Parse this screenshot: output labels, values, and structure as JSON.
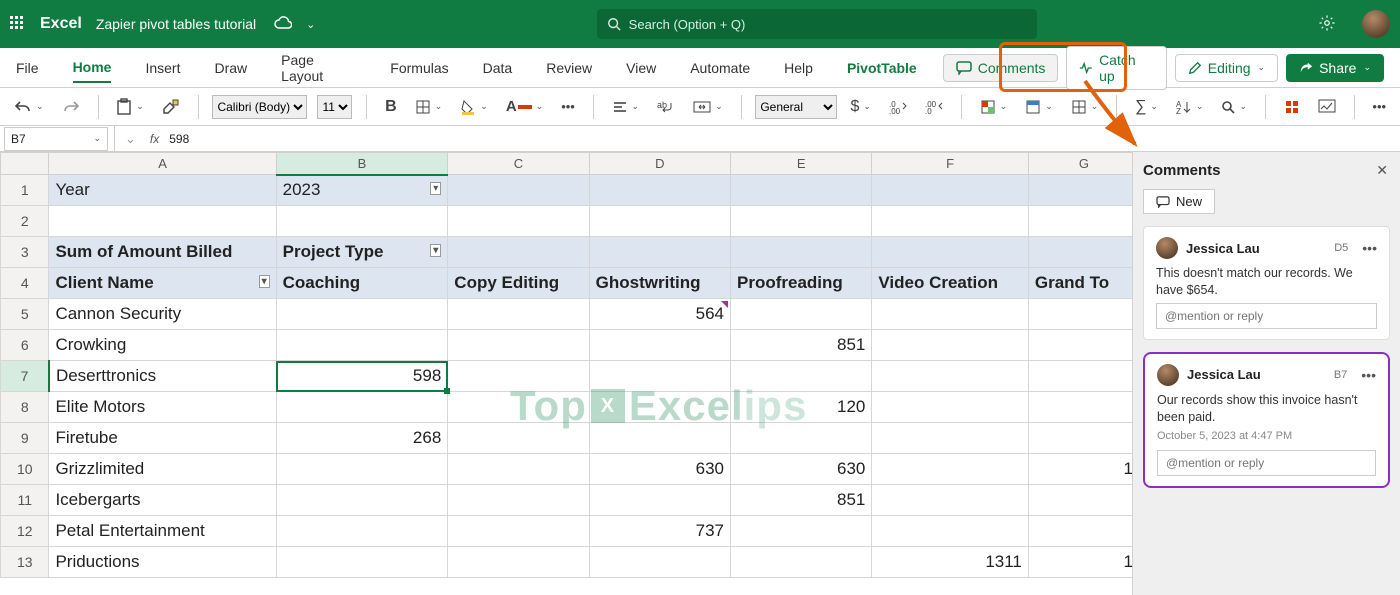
{
  "titlebar": {
    "app": "Excel",
    "doc": "Zapier pivot tables tutorial",
    "search_placeholder": "Search (Option + Q)"
  },
  "tabs": {
    "file": "File",
    "home": "Home",
    "insert": "Insert",
    "draw": "Draw",
    "page_layout": "Page Layout",
    "formulas": "Formulas",
    "data": "Data",
    "review": "Review",
    "view": "View",
    "automate": "Automate",
    "help": "Help",
    "pivot": "PivotTable"
  },
  "actions": {
    "comments": "Comments",
    "catchup": "Catch up",
    "editing": "Editing",
    "share": "Share"
  },
  "toolbar": {
    "font": "Calibri (Body)",
    "size": "11",
    "numfmt": "General"
  },
  "fx": {
    "namebox": "B7",
    "value": "598"
  },
  "columns": [
    "A",
    "B",
    "C",
    "D",
    "E",
    "F",
    "G"
  ],
  "rows": [
    {
      "n": "1",
      "A": "Year",
      "B": "2023",
      "hdr": true,
      "filterB": true
    },
    {
      "n": "2"
    },
    {
      "n": "3",
      "A": "Sum of Amount Billed",
      "B": "Project Type",
      "hdr": true,
      "bold": true,
      "filterB": true
    },
    {
      "n": "4",
      "A": "Client Name",
      "B": "Coaching",
      "C": "Copy Editing",
      "D": "Ghostwriting",
      "E": "Proofreading",
      "F": "Video Creation",
      "G": "Grand To",
      "hdr": true,
      "bold": true,
      "filterA": true
    },
    {
      "n": "5",
      "A": "Cannon Security",
      "D": "564",
      "markD": true
    },
    {
      "n": "6",
      "A": "Crowking",
      "E": "851"
    },
    {
      "n": "7",
      "A": "Deserttronics",
      "B": "598",
      "selB": true
    },
    {
      "n": "8",
      "A": "Elite Motors",
      "E": "120"
    },
    {
      "n": "9",
      "A": "Firetube",
      "B": "268"
    },
    {
      "n": "10",
      "A": "Grizzlimited",
      "D": "630",
      "E": "630",
      "G": "1"
    },
    {
      "n": "11",
      "A": "Icebergarts",
      "E": "851"
    },
    {
      "n": "12",
      "A": "Petal Entertainment",
      "D": "737"
    },
    {
      "n": "13",
      "A": "Priductions",
      "F": "1311",
      "G": "1"
    }
  ],
  "comments_pane": {
    "title": "Comments",
    "new_label": "New",
    "reply_placeholder": "@mention or reply",
    "cards": [
      {
        "author": "Jessica Lau",
        "ref": "D5",
        "body": "This doesn't match our records. We have $654."
      },
      {
        "author": "Jessica Lau",
        "ref": "B7",
        "body": "Our records show this invoice hasn't been paid.",
        "date": "October 5, 2023 at 4:47 PM",
        "selected": true
      }
    ]
  },
  "watermark": {
    "t1": "Top",
    "t2": "Excel",
    "t3": "ips"
  }
}
